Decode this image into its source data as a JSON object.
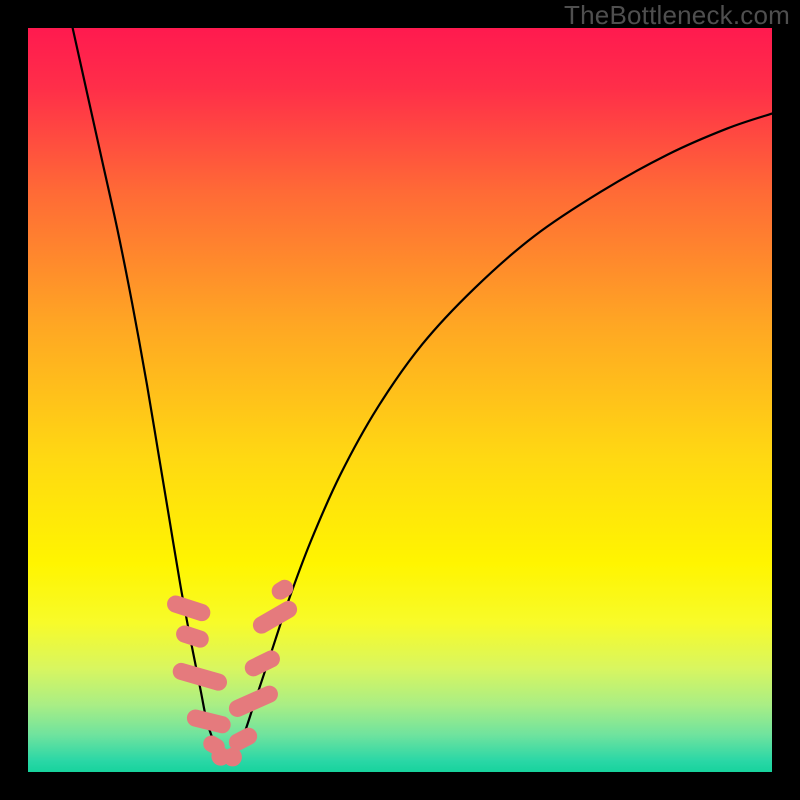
{
  "watermark": "TheBottleneck.com",
  "chart_data": {
    "type": "line",
    "title": "",
    "xlabel": "",
    "ylabel": "",
    "xlim": [
      0,
      100
    ],
    "ylim": [
      0,
      100
    ],
    "grid": false,
    "legend": false,
    "background_gradient": {
      "stops": [
        {
          "pos": 0.0,
          "color": "#ff1a4f"
        },
        {
          "pos": 0.08,
          "color": "#ff2e49"
        },
        {
          "pos": 0.22,
          "color": "#ff6a36"
        },
        {
          "pos": 0.4,
          "color": "#ffa723"
        },
        {
          "pos": 0.58,
          "color": "#ffd912"
        },
        {
          "pos": 0.72,
          "color": "#fff500"
        },
        {
          "pos": 0.8,
          "color": "#f7fb2a"
        },
        {
          "pos": 0.86,
          "color": "#d9f65f"
        },
        {
          "pos": 0.91,
          "color": "#a9ee85"
        },
        {
          "pos": 0.95,
          "color": "#6fe39e"
        },
        {
          "pos": 0.985,
          "color": "#2ad7a6"
        },
        {
          "pos": 1.0,
          "color": "#17d39d"
        }
      ]
    },
    "series": [
      {
        "name": "left-branch",
        "stroke": "#000000",
        "stroke_width": 2.2,
        "x": [
          6.0,
          8.0,
          10.0,
          12.0,
          14.0,
          16.0,
          17.5,
          19.0,
          20.5,
          22.0,
          23.2,
          24.0,
          25.0,
          25.8
        ],
        "y": [
          100.0,
          91.0,
          82.0,
          73.0,
          63.0,
          52.0,
          43.0,
          34.0,
          25.0,
          17.0,
          11.0,
          7.0,
          4.0,
          2.5
        ]
      },
      {
        "name": "right-branch",
        "stroke": "#000000",
        "stroke_width": 2.2,
        "x": [
          27.8,
          29.0,
          30.5,
          32.5,
          35.0,
          38.0,
          42.0,
          47.0,
          53.0,
          60.0,
          68.0,
          77.0,
          86.0,
          94.0,
          100.0
        ],
        "y": [
          2.5,
          5.0,
          9.5,
          15.5,
          23.0,
          31.0,
          40.0,
          49.0,
          57.5,
          65.0,
          72.0,
          78.0,
          83.0,
          86.5,
          88.5
        ]
      },
      {
        "name": "bottom-arc",
        "stroke": "#000000",
        "stroke_width": 2.2,
        "x": [
          25.8,
          26.3,
          26.8,
          27.3,
          27.8
        ],
        "y": [
          2.5,
          2.0,
          1.9,
          2.0,
          2.5
        ]
      }
    ],
    "markers": {
      "color": "#e57a7d",
      "shape": "rounded-rect",
      "points": [
        {
          "x": 21.6,
          "y": 22.0,
          "w": 2.3,
          "h": 6.0,
          "angle": 72
        },
        {
          "x": 22.1,
          "y": 18.2,
          "w": 2.3,
          "h": 4.5,
          "angle": 72
        },
        {
          "x": 23.1,
          "y": 12.8,
          "w": 2.3,
          "h": 7.5,
          "angle": 74
        },
        {
          "x": 24.3,
          "y": 6.8,
          "w": 2.3,
          "h": 6.0,
          "angle": 76
        },
        {
          "x": 25.0,
          "y": 3.6,
          "w": 2.2,
          "h": 3.0,
          "angle": 60
        },
        {
          "x": 25.9,
          "y": 2.1,
          "w": 2.5,
          "h": 2.5,
          "angle": 0
        },
        {
          "x": 27.5,
          "y": 2.0,
          "w": 2.5,
          "h": 2.5,
          "angle": 0
        },
        {
          "x": 28.9,
          "y": 4.4,
          "w": 2.3,
          "h": 4.0,
          "angle": -62
        },
        {
          "x": 30.3,
          "y": 9.5,
          "w": 2.3,
          "h": 7.0,
          "angle": -66
        },
        {
          "x": 31.5,
          "y": 14.6,
          "w": 2.3,
          "h": 5.0,
          "angle": -64
        },
        {
          "x": 33.2,
          "y": 20.8,
          "w": 2.3,
          "h": 6.5,
          "angle": -60
        },
        {
          "x": 34.2,
          "y": 24.5,
          "w": 2.3,
          "h": 3.0,
          "angle": -58
        }
      ]
    }
  }
}
